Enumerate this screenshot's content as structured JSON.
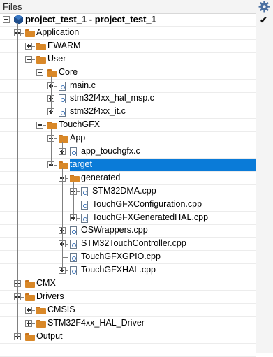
{
  "panel": {
    "title": "Files",
    "check_mark": "✔",
    "options_icon": "gear-icon"
  },
  "tree": [
    {
      "label": "project_test_1 - project_test_1",
      "icon": "project-icon",
      "depth": 0,
      "expander": "minus",
      "bold": true
    },
    {
      "label": "Application",
      "icon": "folder-icon",
      "depth": 1,
      "expander": "minus"
    },
    {
      "label": "EWARM",
      "icon": "folder-icon",
      "depth": 2,
      "expander": "plus"
    },
    {
      "label": "User",
      "icon": "folder-icon",
      "depth": 2,
      "expander": "minus"
    },
    {
      "label": "Core",
      "icon": "folder-icon",
      "depth": 3,
      "expander": "minus"
    },
    {
      "label": "main.c",
      "icon": "c-file-icon",
      "depth": 4,
      "expander": "plus"
    },
    {
      "label": "stm32f4xx_hal_msp.c",
      "icon": "c-file-icon",
      "depth": 4,
      "expander": "plus"
    },
    {
      "label": "stm32f4xx_it.c",
      "icon": "c-file-icon",
      "depth": 4,
      "expander": "plus"
    },
    {
      "label": "TouchGFX",
      "icon": "folder-icon",
      "depth": 3,
      "expander": "minus"
    },
    {
      "label": "App",
      "icon": "folder-icon",
      "depth": 4,
      "expander": "minus"
    },
    {
      "label": "app_touchgfx.c",
      "icon": "c-file-icon",
      "depth": 5,
      "expander": "plus"
    },
    {
      "label": "target",
      "icon": "folder-icon",
      "depth": 4,
      "expander": "minus",
      "selected": true
    },
    {
      "label": "generated",
      "icon": "folder-icon",
      "depth": 5,
      "expander": "minus"
    },
    {
      "label": "STM32DMA.cpp",
      "icon": "cpp-file-icon",
      "depth": 6,
      "expander": "plus"
    },
    {
      "label": "TouchGFXConfiguration.cpp",
      "icon": "cpp-file-icon",
      "depth": 6,
      "expander": "none"
    },
    {
      "label": "TouchGFXGeneratedHAL.cpp",
      "icon": "cpp-file-icon",
      "depth": 6,
      "expander": "plus"
    },
    {
      "label": "OSWrappers.cpp",
      "icon": "cpp-file-icon",
      "depth": 5,
      "expander": "plus"
    },
    {
      "label": "STM32TouchController.cpp",
      "icon": "cpp-file-icon",
      "depth": 5,
      "expander": "plus"
    },
    {
      "label": "TouchGFXGPIO.cpp",
      "icon": "cpp-file-icon",
      "depth": 5,
      "expander": "none"
    },
    {
      "label": "TouchGFXHAL.cpp",
      "icon": "cpp-file-icon",
      "depth": 5,
      "expander": "plus"
    },
    {
      "label": "CMX",
      "icon": "folder-icon",
      "depth": 1,
      "expander": "plus"
    },
    {
      "label": "Drivers",
      "icon": "folder-icon",
      "depth": 1,
      "expander": "minus"
    },
    {
      "label": "CMSIS",
      "icon": "folder-icon",
      "depth": 2,
      "expander": "plus"
    },
    {
      "label": "STM32F4xx_HAL_Driver",
      "icon": "folder-icon",
      "depth": 2,
      "expander": "plus"
    },
    {
      "label": "Output",
      "icon": "folder-icon",
      "depth": 1,
      "expander": "plus"
    }
  ],
  "colors": {
    "selection": "#0a7bd8",
    "folder": "#d98828",
    "tree_lines": "#808080"
  }
}
